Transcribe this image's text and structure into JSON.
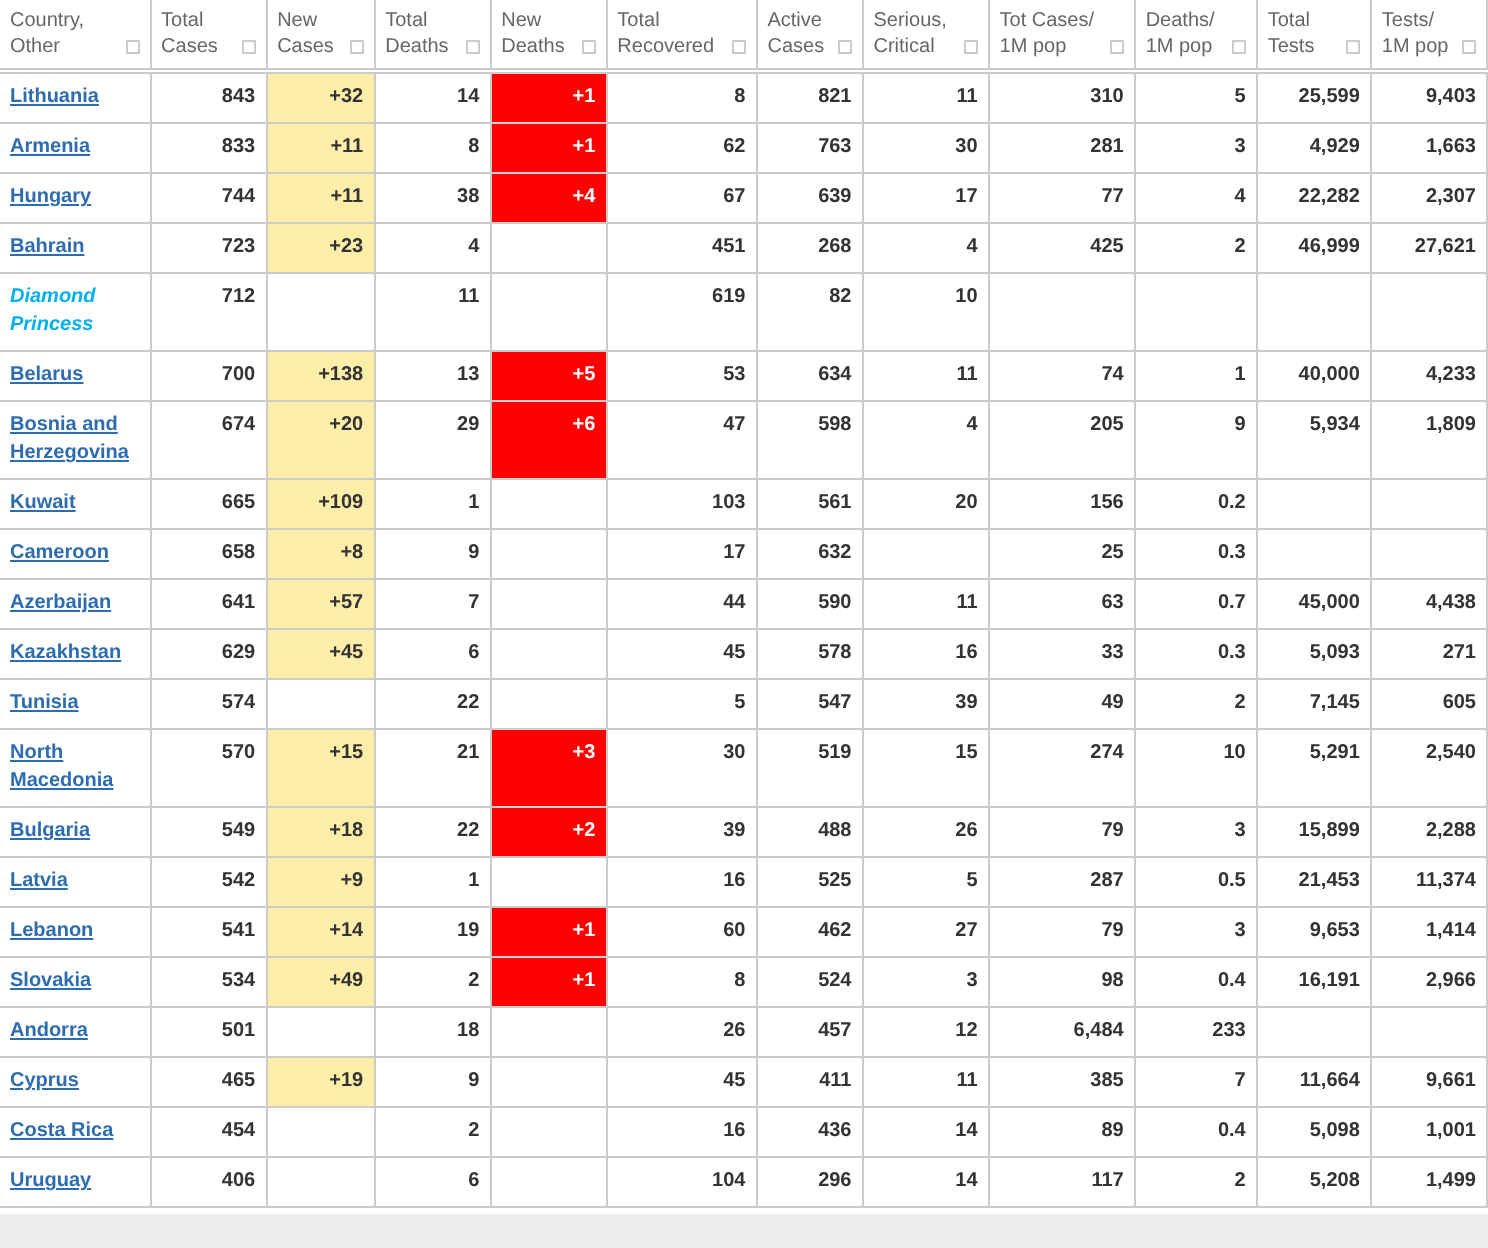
{
  "table": {
    "columns": [
      "Country,\nOther",
      "Total\nCases",
      "New\nCases",
      "Total\nDeaths",
      "New\nDeaths",
      "Total\nRecovered",
      "Active\nCases",
      "Serious,\nCritical",
      "Tot Cases/\n1M pop",
      "Deaths/\n1M pop",
      "Total\nTests",
      "Tests/\n1M pop"
    ],
    "rows": [
      {
        "country": "Lithuania",
        "kind": "link",
        "total_cases": "843",
        "new_cases": "+32",
        "total_deaths": "14",
        "new_deaths": "+1",
        "total_recovered": "8",
        "active_cases": "821",
        "serious": "11",
        "cases_per_million": "310",
        "deaths_per_million": "5",
        "total_tests": "25,599",
        "tests_per_million": "9,403"
      },
      {
        "country": "Armenia",
        "kind": "link",
        "total_cases": "833",
        "new_cases": "+11",
        "total_deaths": "8",
        "new_deaths": "+1",
        "total_recovered": "62",
        "active_cases": "763",
        "serious": "30",
        "cases_per_million": "281",
        "deaths_per_million": "3",
        "total_tests": "4,929",
        "tests_per_million": "1,663"
      },
      {
        "country": "Hungary",
        "kind": "link",
        "total_cases": "744",
        "new_cases": "+11",
        "total_deaths": "38",
        "new_deaths": "+4",
        "total_recovered": "67",
        "active_cases": "639",
        "serious": "17",
        "cases_per_million": "77",
        "deaths_per_million": "4",
        "total_tests": "22,282",
        "tests_per_million": "2,307"
      },
      {
        "country": "Bahrain",
        "kind": "link",
        "total_cases": "723",
        "new_cases": "+23",
        "total_deaths": "4",
        "total_recovered": "451",
        "active_cases": "268",
        "serious": "4",
        "cases_per_million": "425",
        "deaths_per_million": "2",
        "total_tests": "46,999",
        "tests_per_million": "27,621"
      },
      {
        "country": "Diamond Princess",
        "kind": "ship",
        "total_cases": "712",
        "total_deaths": "11",
        "total_recovered": "619",
        "active_cases": "82",
        "serious": "10"
      },
      {
        "country": "Belarus",
        "kind": "link",
        "total_cases": "700",
        "new_cases": "+138",
        "total_deaths": "13",
        "new_deaths": "+5",
        "total_recovered": "53",
        "active_cases": "634",
        "serious": "11",
        "cases_per_million": "74",
        "deaths_per_million": "1",
        "total_tests": "40,000",
        "tests_per_million": "4,233"
      },
      {
        "country": "Bosnia and Herzegovina",
        "kind": "link",
        "total_cases": "674",
        "new_cases": "+20",
        "total_deaths": "29",
        "new_deaths": "+6",
        "total_recovered": "47",
        "active_cases": "598",
        "serious": "4",
        "cases_per_million": "205",
        "deaths_per_million": "9",
        "total_tests": "5,934",
        "tests_per_million": "1,809"
      },
      {
        "country": "Kuwait",
        "kind": "link",
        "total_cases": "665",
        "new_cases": "+109",
        "total_deaths": "1",
        "total_recovered": "103",
        "active_cases": "561",
        "serious": "20",
        "cases_per_million": "156",
        "deaths_per_million": "0.2"
      },
      {
        "country": "Cameroon",
        "kind": "link",
        "total_cases": "658",
        "new_cases": "+8",
        "total_deaths": "9",
        "total_recovered": "17",
        "active_cases": "632",
        "cases_per_million": "25",
        "deaths_per_million": "0.3"
      },
      {
        "country": "Azerbaijan",
        "kind": "link",
        "total_cases": "641",
        "new_cases": "+57",
        "total_deaths": "7",
        "total_recovered": "44",
        "active_cases": "590",
        "serious": "11",
        "cases_per_million": "63",
        "deaths_per_million": "0.7",
        "total_tests": "45,000",
        "tests_per_million": "4,438"
      },
      {
        "country": "Kazakhstan",
        "kind": "link",
        "total_cases": "629",
        "new_cases": "+45",
        "total_deaths": "6",
        "total_recovered": "45",
        "active_cases": "578",
        "serious": "16",
        "cases_per_million": "33",
        "deaths_per_million": "0.3",
        "total_tests": "5,093",
        "tests_per_million": "271"
      },
      {
        "country": "Tunisia",
        "kind": "link",
        "total_cases": "574",
        "total_deaths": "22",
        "total_recovered": "5",
        "active_cases": "547",
        "serious": "39",
        "cases_per_million": "49",
        "deaths_per_million": "2",
        "total_tests": "7,145",
        "tests_per_million": "605"
      },
      {
        "country": "North Macedonia",
        "kind": "link",
        "total_cases": "570",
        "new_cases": "+15",
        "total_deaths": "21",
        "new_deaths": "+3",
        "total_recovered": "30",
        "active_cases": "519",
        "serious": "15",
        "cases_per_million": "274",
        "deaths_per_million": "10",
        "total_tests": "5,291",
        "tests_per_million": "2,540"
      },
      {
        "country": "Bulgaria",
        "kind": "link",
        "total_cases": "549",
        "new_cases": "+18",
        "total_deaths": "22",
        "new_deaths": "+2",
        "total_recovered": "39",
        "active_cases": "488",
        "serious": "26",
        "cases_per_million": "79",
        "deaths_per_million": "3",
        "total_tests": "15,899",
        "tests_per_million": "2,288"
      },
      {
        "country": "Latvia",
        "kind": "link",
        "total_cases": "542",
        "new_cases": "+9",
        "total_deaths": "1",
        "total_recovered": "16",
        "active_cases": "525",
        "serious": "5",
        "cases_per_million": "287",
        "deaths_per_million": "0.5",
        "total_tests": "21,453",
        "tests_per_million": "11,374"
      },
      {
        "country": "Lebanon",
        "kind": "link",
        "total_cases": "541",
        "new_cases": "+14",
        "total_deaths": "19",
        "new_deaths": "+1",
        "total_recovered": "60",
        "active_cases": "462",
        "serious": "27",
        "cases_per_million": "79",
        "deaths_per_million": "3",
        "total_tests": "9,653",
        "tests_per_million": "1,414"
      },
      {
        "country": "Slovakia",
        "kind": "link",
        "total_cases": "534",
        "new_cases": "+49",
        "total_deaths": "2",
        "new_deaths": "+1",
        "total_recovered": "8",
        "active_cases": "524",
        "serious": "3",
        "cases_per_million": "98",
        "deaths_per_million": "0.4",
        "total_tests": "16,191",
        "tests_per_million": "2,966"
      },
      {
        "country": "Andorra",
        "kind": "link",
        "total_cases": "501",
        "total_deaths": "18",
        "total_recovered": "26",
        "active_cases": "457",
        "serious": "12",
        "cases_per_million": "6,484",
        "deaths_per_million": "233"
      },
      {
        "country": "Cyprus",
        "kind": "link",
        "total_cases": "465",
        "new_cases": "+19",
        "total_deaths": "9",
        "total_recovered": "45",
        "active_cases": "411",
        "serious": "11",
        "cases_per_million": "385",
        "deaths_per_million": "7",
        "total_tests": "11,664",
        "tests_per_million": "9,661"
      },
      {
        "country": "Costa Rica",
        "kind": "link",
        "total_cases": "454",
        "total_deaths": "2",
        "total_recovered": "16",
        "active_cases": "436",
        "serious": "14",
        "cases_per_million": "89",
        "deaths_per_million": "0.4",
        "total_tests": "5,098",
        "tests_per_million": "1,001"
      },
      {
        "country": "Uruguay",
        "kind": "link",
        "total_cases": "406",
        "total_deaths": "6",
        "total_recovered": "104",
        "active_cases": "296",
        "serious": "14",
        "cases_per_million": "117",
        "deaths_per_million": "2",
        "total_tests": "5,208",
        "tests_per_million": "1,499"
      }
    ]
  }
}
